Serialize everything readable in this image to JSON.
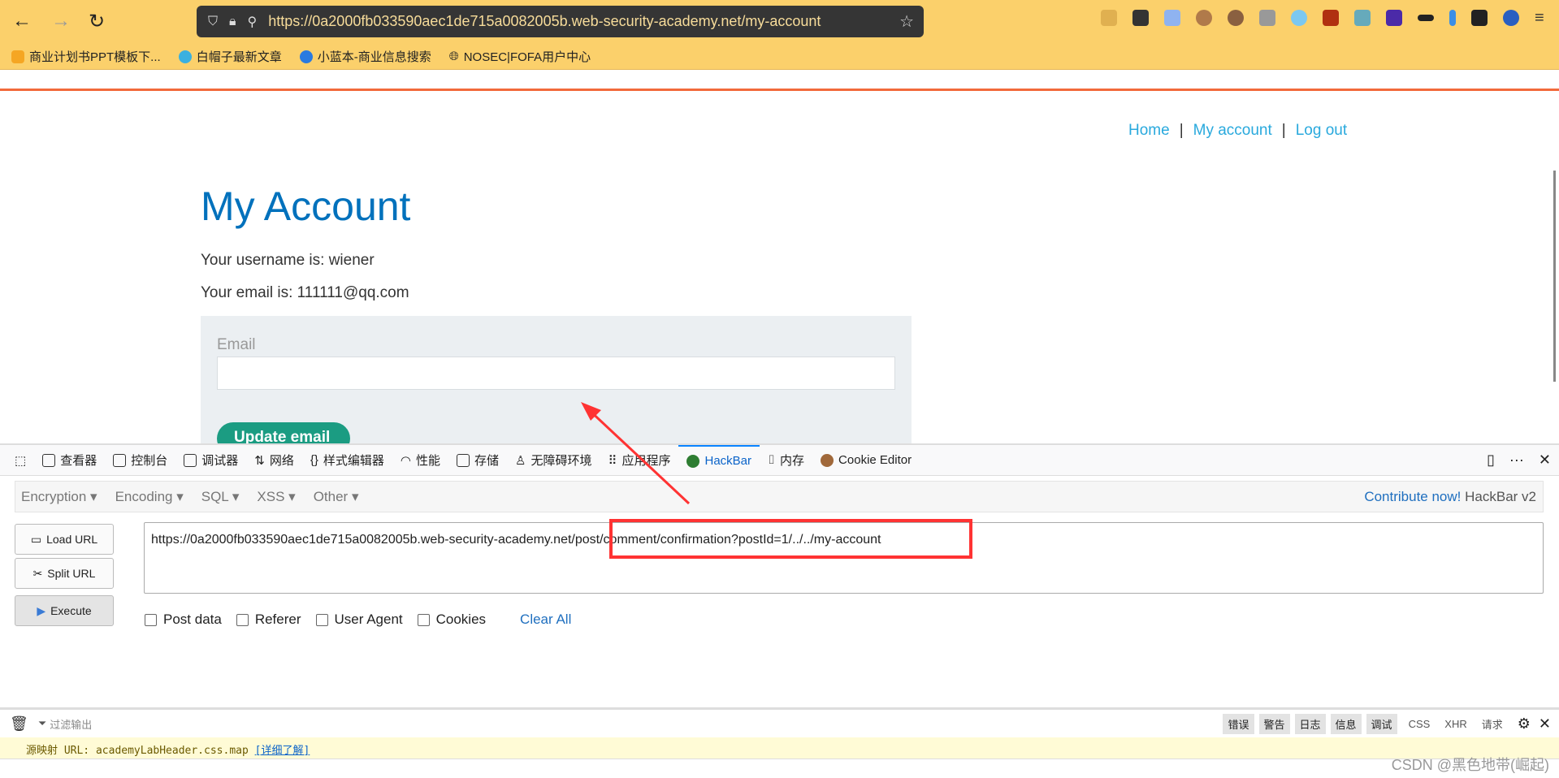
{
  "browser": {
    "url": "https://0a2000fb033590aec1de715a0082005b.web-security-academy.net/my-account",
    "bookmarks": [
      "商业计划书PPT模板下...",
      "白帽子最新文章",
      "小蓝本-商业信息搜索",
      "NOSEC|FOFA用户中心"
    ]
  },
  "nav": {
    "home": "Home",
    "sep": "|",
    "account": "My account",
    "logout": "Log out"
  },
  "page": {
    "title": "My Account",
    "username": "Your username is: wiener",
    "email": "Your email is: 111111@qq.com",
    "email_label": "Email",
    "email_value": "",
    "update_button": "Update email"
  },
  "devtools": {
    "tabs": [
      "查看器",
      "控制台",
      "调试器",
      "网络",
      "样式编辑器",
      "性能",
      "存储",
      "无障碍环境",
      "应用程序",
      "HackBar",
      "内存",
      "Cookie Editor"
    ]
  },
  "hackbar": {
    "menus": [
      "Encryption",
      "Encoding",
      "SQL",
      "XSS",
      "Other"
    ],
    "contribute": "Contribute now!",
    "version": "HackBar v2",
    "load_url": "Load URL",
    "split_url": "Split URL",
    "execute": "Execute",
    "url_value": "https://0a2000fb033590aec1de715a0082005b.web-security-academy.net/post/comment/confirmation?postId=1/../../my-account",
    "checkboxes": [
      "Post data",
      "Referer",
      "User Agent",
      "Cookies"
    ],
    "clear_all": "Clear All"
  },
  "console": {
    "filter_placeholder": "过滤输出",
    "levels": [
      "错误",
      "警告",
      "日志",
      "信息",
      "调试"
    ],
    "extra": [
      "CSS",
      "XHR",
      "请求"
    ],
    "log_prefix": "源映射 URL: academyLabHeader.css.map",
    "log_link": "[详细了解]"
  },
  "watermark": "CSDN @黑色地带(崛起)",
  "colors": {
    "accent": "#0071bc",
    "button": "#1b9c82",
    "annotation": "#ff3333"
  }
}
